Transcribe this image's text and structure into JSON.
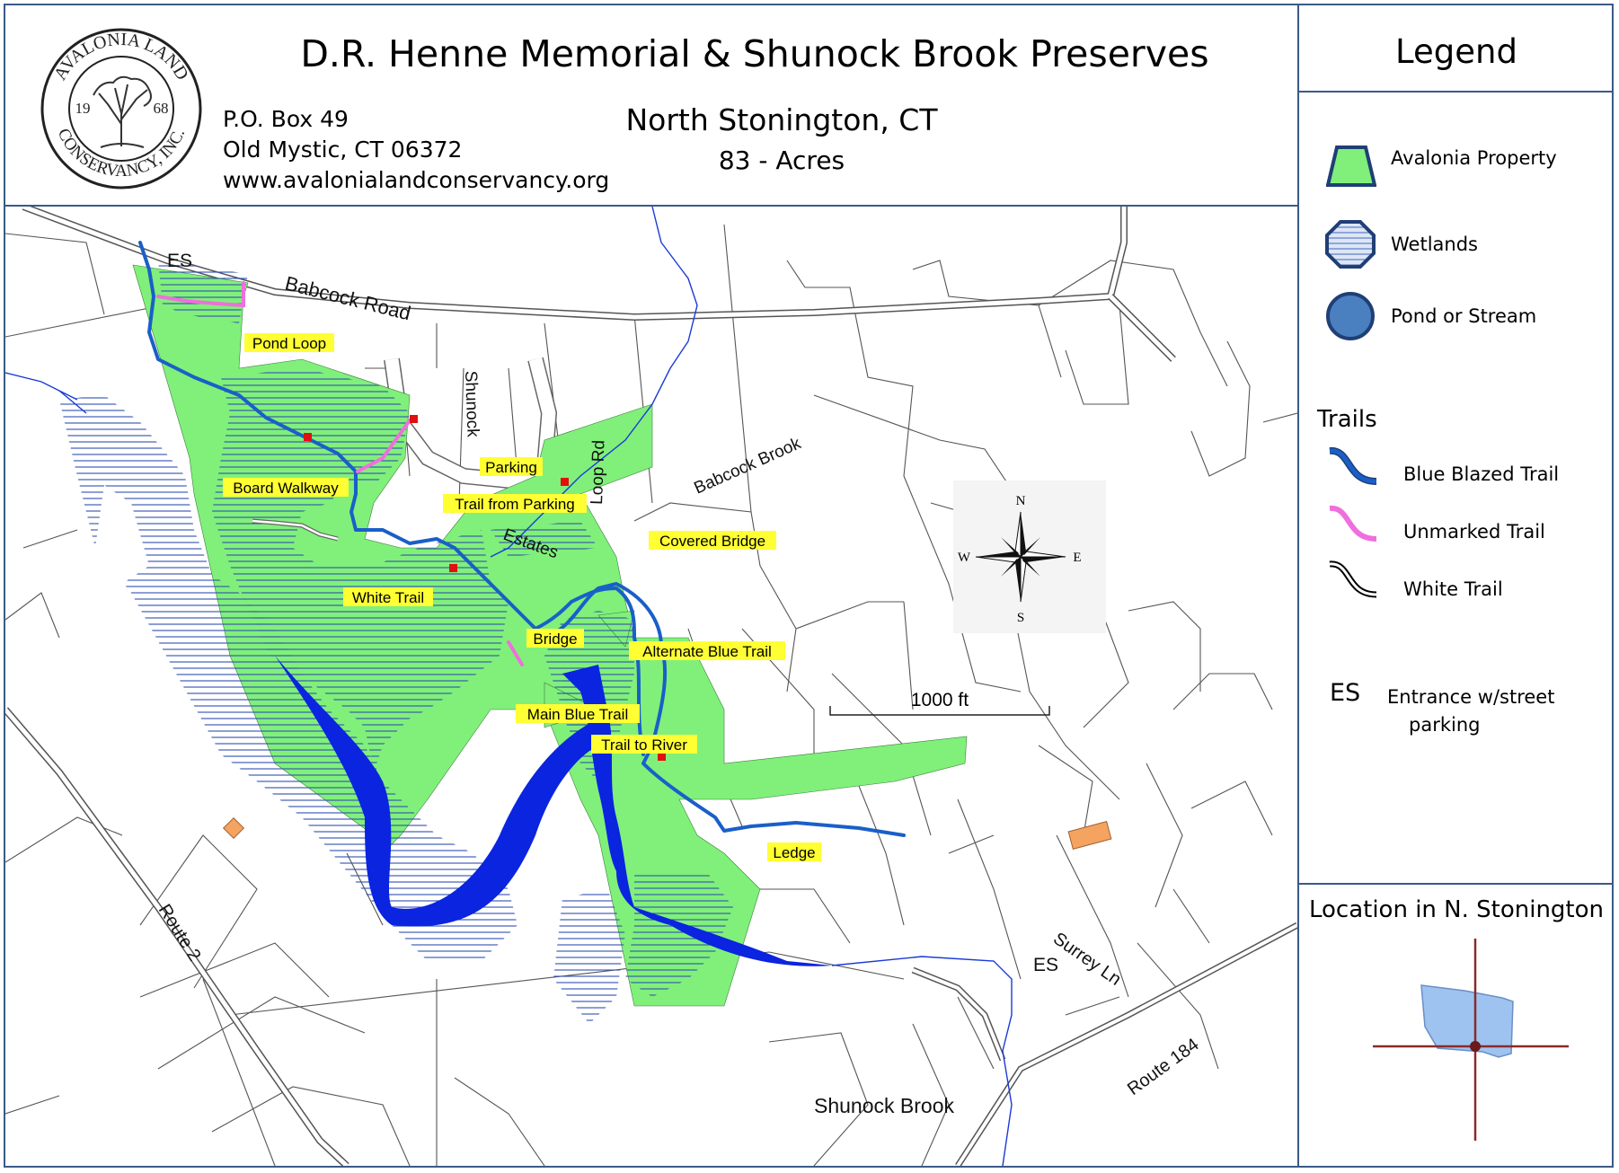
{
  "header": {
    "title": "D.R. Henne Memorial & Shunock Brook Preserves",
    "location": "North Stonington, CT",
    "acres": "83 - Acres",
    "address_line1": "P.O. Box 49",
    "address_line2": "Old Mystic, CT 06372",
    "website": "www.avalonialandconservancy.org",
    "logo_text": "AVALONIA LAND CONSERVANCY, INC.",
    "logo_year_left": "19",
    "logo_year_right": "68"
  },
  "legend": {
    "title": "Legend",
    "items": [
      {
        "label": "Avalonia Property",
        "icon": "property-swatch",
        "color": "#80f07a"
      },
      {
        "label": "Wetlands",
        "icon": "wetlands-swatch",
        "color": "#2f4fb0"
      },
      {
        "label": "Pond or Stream",
        "icon": "pond-swatch",
        "color": "#4a7fc0"
      }
    ],
    "trails_heading": "Trails",
    "trails": [
      {
        "label": "Blue Blazed Trail",
        "icon": "blue-trail-line",
        "color": "#1a5fc8"
      },
      {
        "label": "Unmarked Trail",
        "icon": "pink-trail-line",
        "color": "#ef6fdc"
      },
      {
        "label": "White Trail",
        "icon": "white-trail-line",
        "color": "#000000"
      }
    ],
    "es_symbol": "ES",
    "es_label_line1": "Entrance w/street",
    "es_label_line2": "parking"
  },
  "location_inset": {
    "title": "Location in N. Stonington"
  },
  "map": {
    "roads": {
      "babcock_road": "Babcock Road",
      "shunock": "Shunock",
      "estates": "Estates",
      "loop_rd": "Loop Rd",
      "surrey_ln": "Surrey Ln",
      "route_2": "Route 2",
      "route_184": "Route 184"
    },
    "water": {
      "babcock_brook": "Babcock Brook",
      "shunock_brook": "Shunock Brook"
    },
    "entrances": [
      "ES",
      "ES"
    ],
    "points": {
      "pond_loop": "Pond Loop",
      "parking": "Parking",
      "board_walkway": "Board Walkway",
      "trail_from_parking": "Trail from Parking",
      "covered_bridge": "Covered Bridge",
      "white_trail": "White Trail",
      "bridge": "Bridge",
      "alternate_blue_trail": "Alternate Blue Trail",
      "main_blue_trail": "Main Blue Trail",
      "trail_to_river": "Trail to River",
      "ledge": "Ledge"
    },
    "compass": {
      "n": "N",
      "s": "S",
      "e": "E",
      "w": "W"
    },
    "scale_label": "1000 ft",
    "colors": {
      "property": "#80f07a",
      "wetland_hatch": "#2f4fb0",
      "stream": "#0a24e0",
      "blue_trail": "#1a5fc8",
      "unmarked_trail": "#ef6fdc",
      "label_bg": "#ffff33",
      "marker": "#e01010",
      "building": "#f4a460"
    }
  }
}
